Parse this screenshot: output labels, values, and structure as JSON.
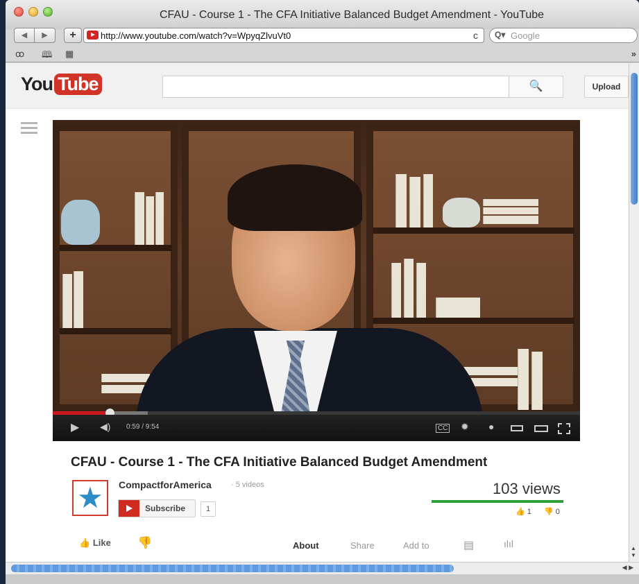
{
  "window": {
    "title": "CFAU - Course 1 - The CFA Initiative Balanced Budget Amendment - YouTube"
  },
  "toolbar": {
    "back_label": "◀",
    "forward_label": "▶",
    "add_label": "+",
    "url": "http://www.youtube.com/watch?v=WpyqZlvuVt0",
    "reload_label": "ᴄ",
    "search_icon": "Q▾",
    "search_placeholder": "Google"
  },
  "bookmarks_bar": {
    "reading_list_icon": "ꝏ",
    "book_icon": "🕮",
    "grid_icon": "▦",
    "more_label": "»"
  },
  "youtube": {
    "logo_you": "You",
    "logo_tube": "Tube",
    "search_value": "",
    "search_icon": "🔍",
    "upload_label": "Upload"
  },
  "player": {
    "time": "0:59 / 9:54",
    "progress_played": 0.108,
    "progress_buffered": 0.18,
    "cc_label": "CC"
  },
  "video": {
    "title": "CFAU - Course 1 - The CFA Initiative Balanced Budget Amendment",
    "channel_name": "CompactforAmerica",
    "channel_videos": "· 5 videos",
    "subscribe_label": "Subscribe",
    "subscriber_count": "1",
    "views": "103 views",
    "likes": "1",
    "dislikes": "0",
    "like_ratio": 1.0
  },
  "actions": {
    "like_label": "Like",
    "tabs": [
      "About",
      "Share",
      "Add to"
    ]
  },
  "colors": {
    "youtube_red": "#d23327",
    "progress_red": "#cc181e",
    "like_green": "#2f9f3a",
    "channel_star": "#2c8cc6"
  }
}
